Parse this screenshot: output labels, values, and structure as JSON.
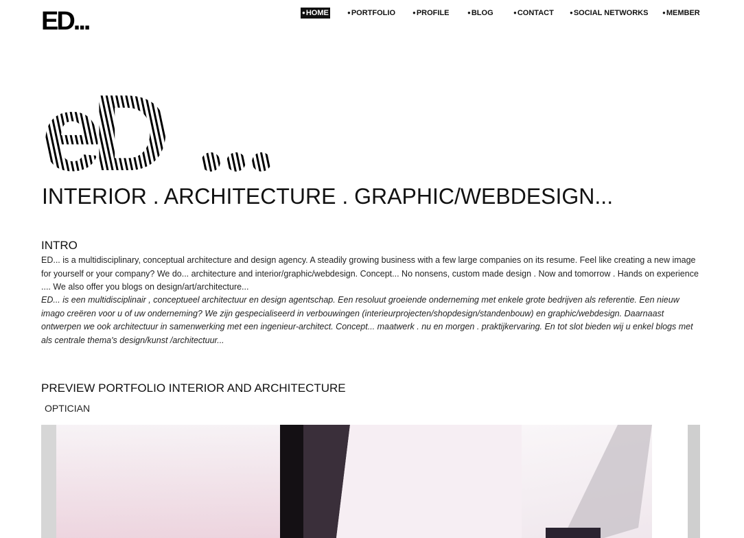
{
  "header": {
    "logo_text": "ED..."
  },
  "nav": {
    "items": [
      {
        "label": "HOME",
        "active": true
      },
      {
        "label": "PORTFOLIO",
        "active": false
      },
      {
        "label": "PROFILE",
        "active": false
      },
      {
        "label": "BLOG",
        "active": false
      },
      {
        "label": "CONTACT",
        "active": false
      },
      {
        "label": "SOCIAL NETWORKS",
        "active": false
      },
      {
        "label": "MEMBER",
        "active": false
      }
    ]
  },
  "hero": {
    "logo_text": "ED...",
    "tagline": "INTERIOR . ARCHITECTURE . GRAPHIC/WEBDESIGN..."
  },
  "intro": {
    "title": "INTRO",
    "text_en": "ED... is a multidisciplinary, conceptual architecture and design agency. A steadily growing business with a few large companies on its resume. Feel like creating a new image for yourself or your company? We do... architecture and interior/graphic/webdesign.  Concept... No nonsens, custom made design . Now and tomorrow . Hands on experience ....  We also offer you blogs on design/art/architecture...",
    "text_nl": "ED... is een multidisciplinair , conceptueel architectuur en design agentschap. Een resoluut groeiende onderneming met enkele grote bedrijven als referentie. Een nieuw imago creëren voor u of uw onderneming? We zijn gespecialiseerd in verbouwingen (interieurprojecten/shopdesign/standenbouw) en graphic/webdesign. Daarnaast ontwerpen we ook architectuur in samenwerking met een ingenieur-architect. Concept... maatwerk . nu en morgen . praktijkervaring.  En tot slot bieden wij u enkel blogs met als centrale thema's design/kunst /architectuur..."
  },
  "portfolio": {
    "title": "PREVIEW PORTFOLIO INTERIOR AND ARCHITECTURE",
    "project_label": "OPTICIAN"
  },
  "colors": {
    "text": "#111111",
    "background": "#ffffff",
    "nav_active_bg": "#111111"
  }
}
